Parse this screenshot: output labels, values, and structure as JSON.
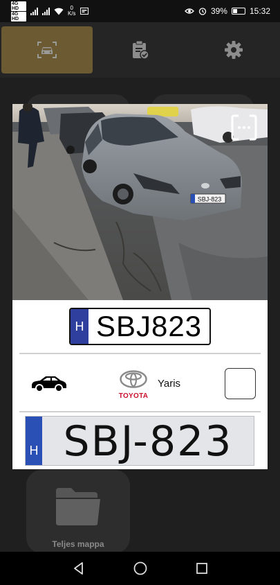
{
  "status_bar": {
    "sim1": "4G HD",
    "sim2": "4G HD",
    "net_speed_value": "0",
    "net_speed_unit": "K/s",
    "battery": "39%",
    "time": "15:32"
  },
  "top_nav": {
    "tabs": [
      {
        "icon": "car-scan-icon",
        "active": true
      },
      {
        "icon": "clipboard-check-icon",
        "active": false
      },
      {
        "icon": "gear-icon",
        "active": false
      }
    ]
  },
  "background": {
    "folder_label": "Teljes mappa"
  },
  "result": {
    "plate_country": "H",
    "plate_text": "SBJ823",
    "vehicle_type_icon": "car-icon",
    "brand": "TOYOTA",
    "model": "Yaris",
    "plate_crop_country": "H",
    "plate_crop_text": "SBJ-823",
    "photo_plate_text": "SBJ-823"
  },
  "colors": {
    "accent": "#6b5a32",
    "plate_eu_blue": "#2f3f9e",
    "toyota_red": "#c8102e"
  }
}
